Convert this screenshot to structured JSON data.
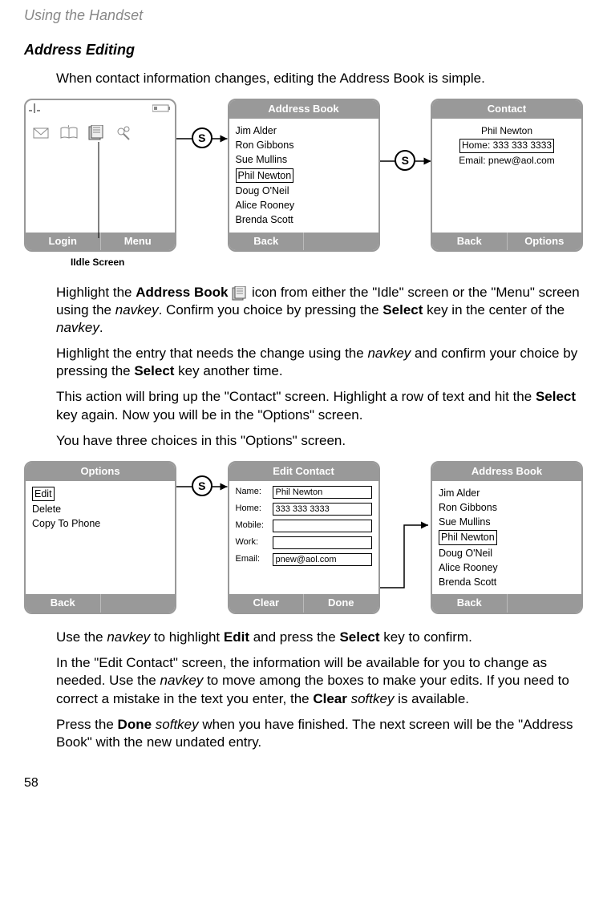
{
  "chapter": "Using the Handset",
  "section_title": "Address Editing",
  "intro": "When contact information changes, editing the Address Book is simple.",
  "idle_label": "IIdle Screen",
  "screens_row1": {
    "idle": {
      "footer_left": "Login",
      "footer_right": "Menu"
    },
    "addrbook": {
      "title": "Address Book",
      "items": [
        "Jim Alder",
        "Ron Gibbons",
        "Sue Mullins",
        "Phil Newton",
        "Doug O'Neil",
        "Alice Rooney",
        "Brenda Scott"
      ],
      "highlight_index": 3,
      "footer_left": "Back",
      "footer_right": ""
    },
    "contact": {
      "title": "Contact",
      "name": "Phil Newton",
      "home": "Home: 333 333 3333",
      "email": "Email: pnew@aol.com",
      "footer_left": "Back",
      "footer_right": "Options"
    }
  },
  "para1a": "Highlight the ",
  "para1b": "Address Book",
  "para1c": " icon from either the \"Idle\" screen or the \"Menu\" screen using the ",
  "para1d": "navkey",
  "para1e": ". Confirm you choice by pressing the ",
  "para1f": "Select",
  "para1g": " key in the center of the ",
  "para1h": "navkey",
  "para1i": ".",
  "para2a": "Highlight the entry that needs the change using the ",
  "para2b": "navkey",
  "para2c": " and confirm your choice by pressing the ",
  "para2d": "Select",
  "para2e": " key another time.",
  "para3a": "This action will bring up the \"Contact\" screen. Highlight a row of text and hit the ",
  "para3b": "Select",
  "para3c": " key again. Now you will be in the \"Options\" screen.",
  "para4": "You have three choices in this \"Options\" screen.",
  "screens_row2": {
    "options": {
      "title": "Options",
      "items": [
        "Edit",
        "Delete",
        "Copy To Phone"
      ],
      "highlight_index": 0,
      "footer_left": "Back",
      "footer_right": ""
    },
    "editcontact": {
      "title": "Edit Contact",
      "fields": {
        "name_label": "Name:",
        "name_value": "Phil Newton",
        "home_label": "Home:",
        "home_value": "333 333 3333",
        "mobile_label": "Mobile:",
        "mobile_value": "",
        "work_label": "Work:",
        "work_value": "",
        "email_label": "Email:",
        "email_value": "pnew@aol.com"
      },
      "footer_left": "Clear",
      "footer_right": "Done"
    },
    "addrbook2": {
      "title": "Address Book",
      "items": [
        "Jim Alder",
        "Ron Gibbons",
        "Sue Mullins",
        "Phil Newton",
        "Doug O'Neil",
        "Alice Rooney",
        "Brenda Scott"
      ],
      "highlight_index": 3,
      "footer_left": "Back",
      "footer_right": ""
    }
  },
  "para5a": "Use the ",
  "para5b": "navkey",
  "para5c": " to highlight ",
  "para5d": "Edit",
  "para5e": " and press the ",
  "para5f": "Select",
  "para5g": " key to confirm.",
  "para6a": "In the \"Edit Contact\" screen, the information will be available for you to change as needed. Use the ",
  "para6b": "navkey",
  "para6c": " to move among the boxes to make your edits. If you need to correct a mistake in the text you enter, the ",
  "para6d": "Clear",
  "para6e": " softkey",
  "para6f": " is available.",
  "para7a": "Press the ",
  "para7b": "Done",
  "para7c": " softkey",
  "para7d": " when you have finished. The next screen will be the \"Address Book\" with the new undated entry.",
  "page_number": "58"
}
